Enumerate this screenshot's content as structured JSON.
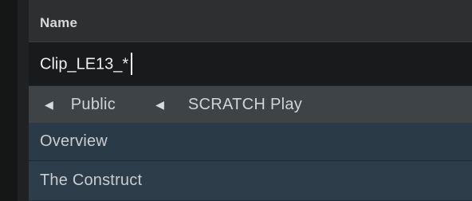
{
  "header": {
    "label": "Name"
  },
  "search": {
    "value": "Clip_LE13_*"
  },
  "breadcrumb": {
    "items": [
      {
        "label": "Public"
      },
      {
        "label": "SCRATCH Play"
      }
    ]
  },
  "list": {
    "items": [
      {
        "label": "Overview"
      },
      {
        "label": "The Construct"
      }
    ]
  },
  "icons": {
    "back": "left-triangle-arrow"
  }
}
